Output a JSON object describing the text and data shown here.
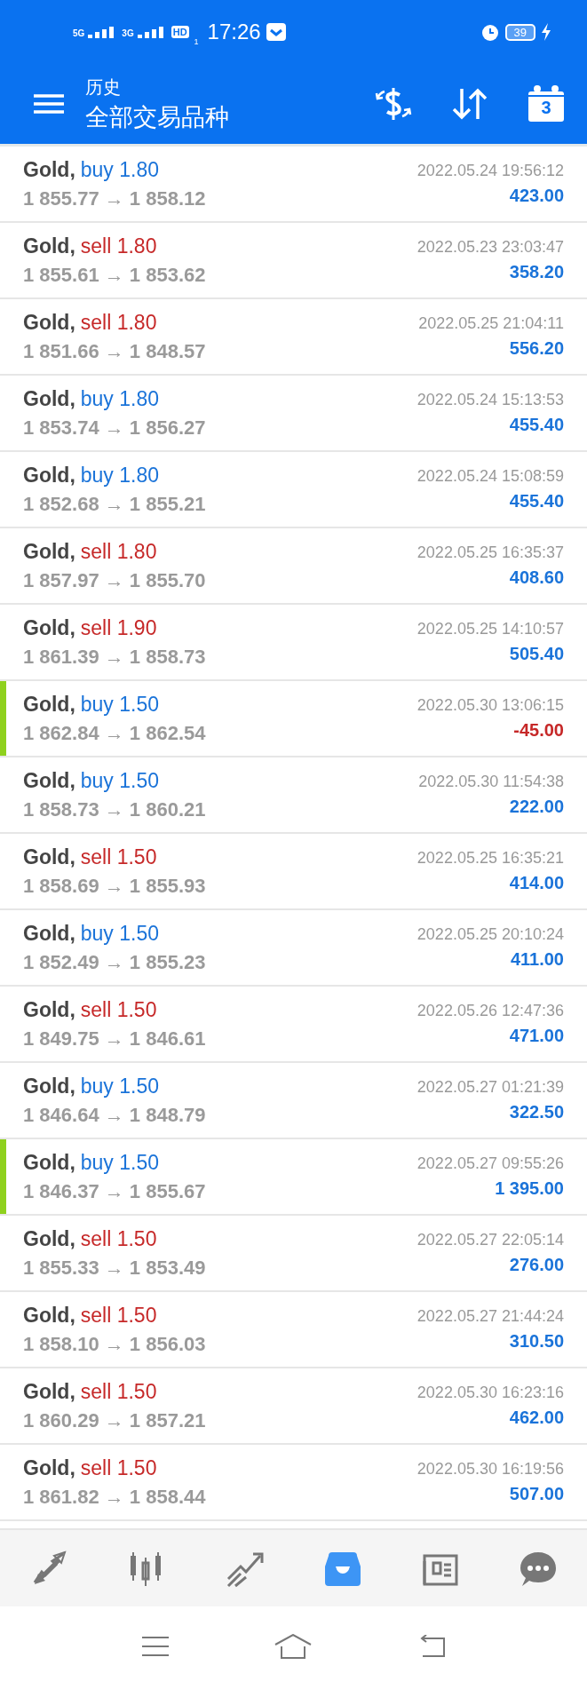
{
  "status_bar": {
    "network_1": "5G",
    "network_2": "3G",
    "hd": "HD",
    "sim": "1",
    "time": "17:26",
    "battery": "39"
  },
  "app_bar": {
    "subtitle": "历史",
    "title": "全部交易品种",
    "calendar_day": "3"
  },
  "trades": [
    {
      "symbol": "Gold,",
      "kind": "buy",
      "order": "buy 1.80",
      "prices": "1 855.77 → 1 858.12",
      "time": "2022.05.24 19:56:12",
      "profit": "423.00",
      "negative": false,
      "highlighted": false
    },
    {
      "symbol": "Gold,",
      "kind": "sell",
      "order": "sell 1.80",
      "prices": "1 855.61 → 1 853.62",
      "time": "2022.05.23 23:03:47",
      "profit": "358.20",
      "negative": false,
      "highlighted": false
    },
    {
      "symbol": "Gold,",
      "kind": "sell",
      "order": "sell 1.80",
      "prices": "1 851.66 → 1 848.57",
      "time": "2022.05.25 21:04:11",
      "profit": "556.20",
      "negative": false,
      "highlighted": false
    },
    {
      "symbol": "Gold,",
      "kind": "buy",
      "order": "buy 1.80",
      "prices": "1 853.74 → 1 856.27",
      "time": "2022.05.24 15:13:53",
      "profit": "455.40",
      "negative": false,
      "highlighted": false
    },
    {
      "symbol": "Gold,",
      "kind": "buy",
      "order": "buy 1.80",
      "prices": "1 852.68 → 1 855.21",
      "time": "2022.05.24 15:08:59",
      "profit": "455.40",
      "negative": false,
      "highlighted": false
    },
    {
      "symbol": "Gold,",
      "kind": "sell",
      "order": "sell 1.80",
      "prices": "1 857.97 → 1 855.70",
      "time": "2022.05.25 16:35:37",
      "profit": "408.60",
      "negative": false,
      "highlighted": false
    },
    {
      "symbol": "Gold,",
      "kind": "sell",
      "order": "sell 1.90",
      "prices": "1 861.39 → 1 858.73",
      "time": "2022.05.25 14:10:57",
      "profit": "505.40",
      "negative": false,
      "highlighted": false
    },
    {
      "symbol": "Gold,",
      "kind": "buy",
      "order": "buy 1.50",
      "prices": "1 862.84 → 1 862.54",
      "time": "2022.05.30 13:06:15",
      "profit": "-45.00",
      "negative": true,
      "highlighted": true
    },
    {
      "symbol": "Gold,",
      "kind": "buy",
      "order": "buy 1.50",
      "prices": "1 858.73 → 1 860.21",
      "time": "2022.05.30 11:54:38",
      "profit": "222.00",
      "negative": false,
      "highlighted": false
    },
    {
      "symbol": "Gold,",
      "kind": "sell",
      "order": "sell 1.50",
      "prices": "1 858.69 → 1 855.93",
      "time": "2022.05.25 16:35:21",
      "profit": "414.00",
      "negative": false,
      "highlighted": false
    },
    {
      "symbol": "Gold,",
      "kind": "buy",
      "order": "buy 1.50",
      "prices": "1 852.49 → 1 855.23",
      "time": "2022.05.25 20:10:24",
      "profit": "411.00",
      "negative": false,
      "highlighted": false
    },
    {
      "symbol": "Gold,",
      "kind": "sell",
      "order": "sell 1.50",
      "prices": "1 849.75 → 1 846.61",
      "time": "2022.05.26 12:47:36",
      "profit": "471.00",
      "negative": false,
      "highlighted": false
    },
    {
      "symbol": "Gold,",
      "kind": "buy",
      "order": "buy 1.50",
      "prices": "1 846.64 → 1 848.79",
      "time": "2022.05.27 01:21:39",
      "profit": "322.50",
      "negative": false,
      "highlighted": false
    },
    {
      "symbol": "Gold,",
      "kind": "buy",
      "order": "buy 1.50",
      "prices": "1 846.37 → 1 855.67",
      "time": "2022.05.27 09:55:26",
      "profit": "1 395.00",
      "negative": false,
      "highlighted": true
    },
    {
      "symbol": "Gold,",
      "kind": "sell",
      "order": "sell 1.50",
      "prices": "1 855.33 → 1 853.49",
      "time": "2022.05.27 22:05:14",
      "profit": "276.00",
      "negative": false,
      "highlighted": false
    },
    {
      "symbol": "Gold,",
      "kind": "sell",
      "order": "sell 1.50",
      "prices": "1 858.10 → 1 856.03",
      "time": "2022.05.27 21:44:24",
      "profit": "310.50",
      "negative": false,
      "highlighted": false
    },
    {
      "symbol": "Gold,",
      "kind": "sell",
      "order": "sell 1.50",
      "prices": "1 860.29 → 1 857.21",
      "time": "2022.05.30 16:23:16",
      "profit": "462.00",
      "negative": false,
      "highlighted": false
    },
    {
      "symbol": "Gold,",
      "kind": "sell",
      "order": "sell 1.50",
      "prices": "1 861.82 → 1 858.44",
      "time": "2022.05.30 16:19:56",
      "profit": "507.00",
      "negative": false,
      "highlighted": false
    }
  ],
  "bottom_tabs": [
    {
      "kind": "trade",
      "selected": false
    },
    {
      "kind": "quotes",
      "selected": false
    },
    {
      "kind": "chart",
      "selected": false
    },
    {
      "kind": "history",
      "selected": true
    },
    {
      "kind": "news",
      "selected": false
    },
    {
      "kind": "chat",
      "selected": false
    }
  ]
}
